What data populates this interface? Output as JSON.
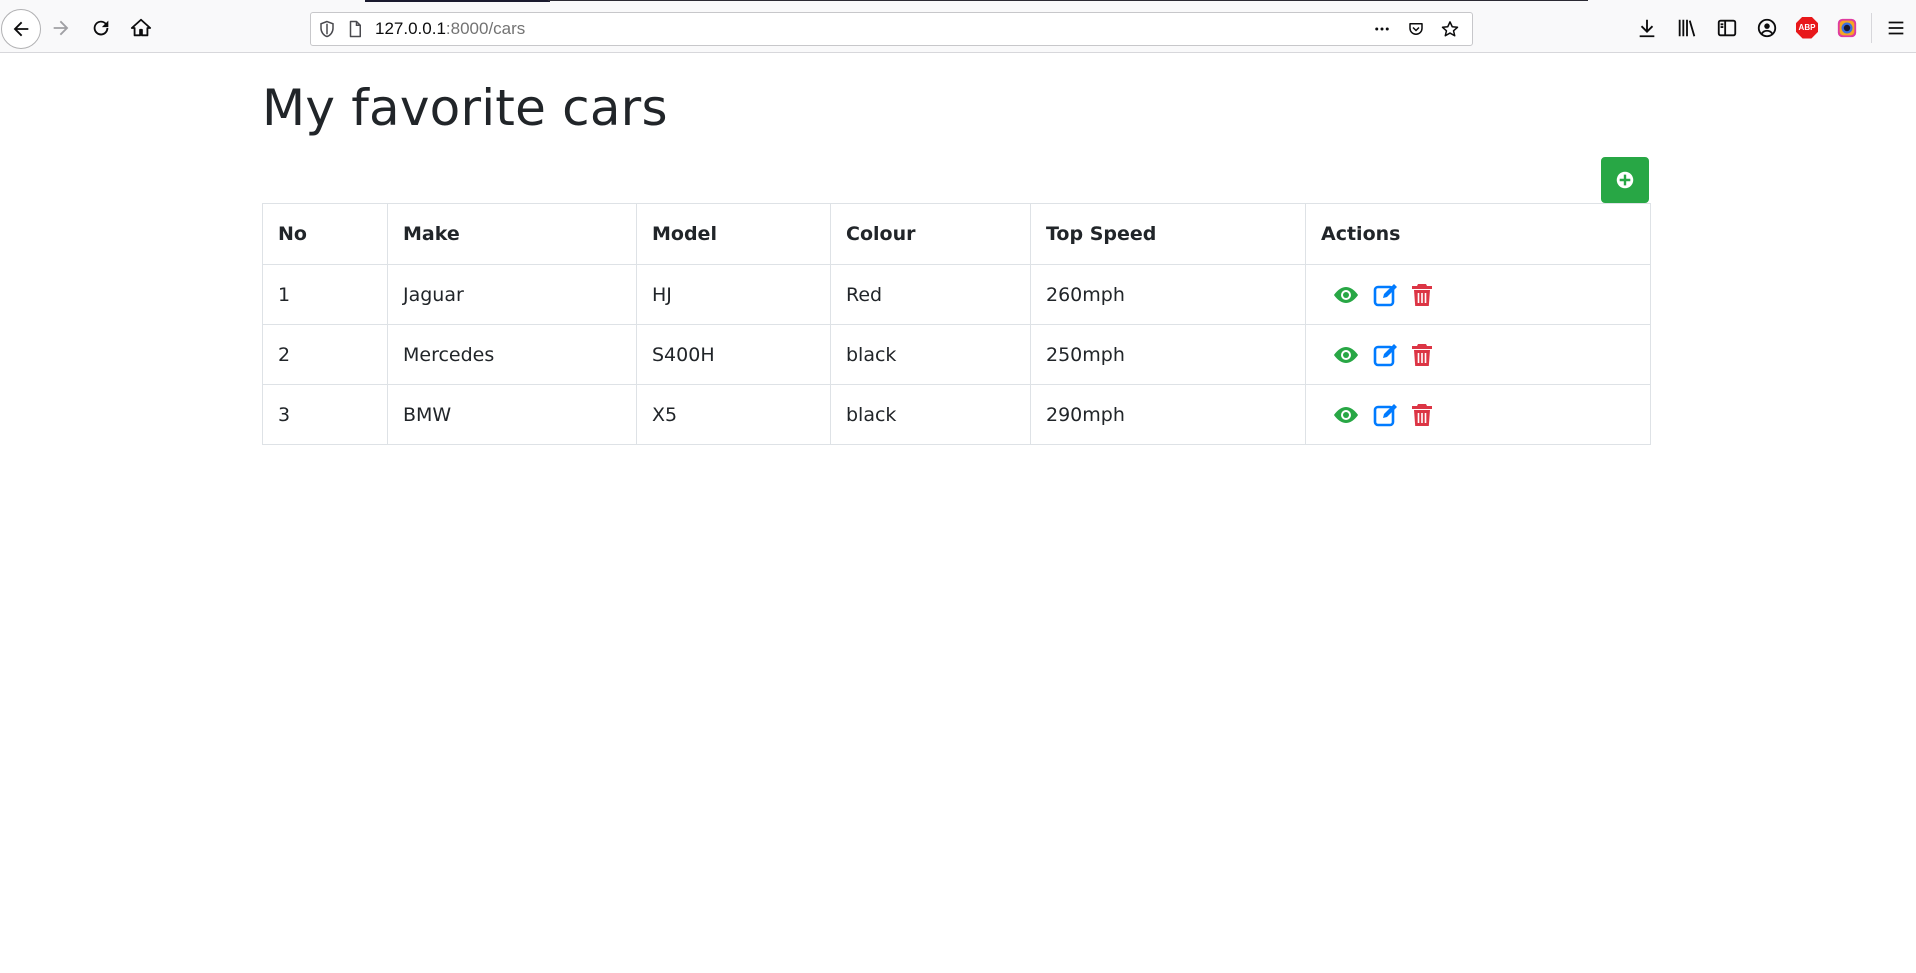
{
  "browser": {
    "url_host": "127.0.0.1",
    "url_path": ":8000/cars",
    "icons": [
      "back-icon",
      "forward-icon",
      "reload-icon",
      "home-icon",
      "shield-icon",
      "page-icon",
      "more-icon",
      "pocket-icon",
      "star-icon",
      "download-icon",
      "library-icon",
      "sidebar-icon",
      "account-icon",
      "adblock-icon",
      "extension-icon",
      "menu-icon"
    ],
    "adblock_label": "ABP"
  },
  "page": {
    "title": "My favorite cars",
    "add_button_icon": "plus-circle-icon",
    "accent_color": "#28a745"
  },
  "table": {
    "headers": {
      "no": "No",
      "make": "Make",
      "model": "Model",
      "colour": "Colour",
      "top_speed": "Top Speed",
      "actions": "Actions"
    },
    "rows": [
      {
        "no": "1",
        "make": "Jaguar",
        "model": "HJ",
        "colour": "Red",
        "top_speed": "260mph"
      },
      {
        "no": "2",
        "make": "Mercedes",
        "model": "S400H",
        "colour": "black",
        "top_speed": "250mph"
      },
      {
        "no": "3",
        "make": "BMW",
        "model": "X5",
        "colour": "black",
        "top_speed": "290mph"
      }
    ],
    "action_icons": {
      "view": {
        "icon": "eye-icon",
        "color": "#28a745"
      },
      "edit": {
        "icon": "edit-icon",
        "color": "#007bff"
      },
      "delete": {
        "icon": "trash-icon",
        "color": "#dc3545"
      }
    }
  }
}
